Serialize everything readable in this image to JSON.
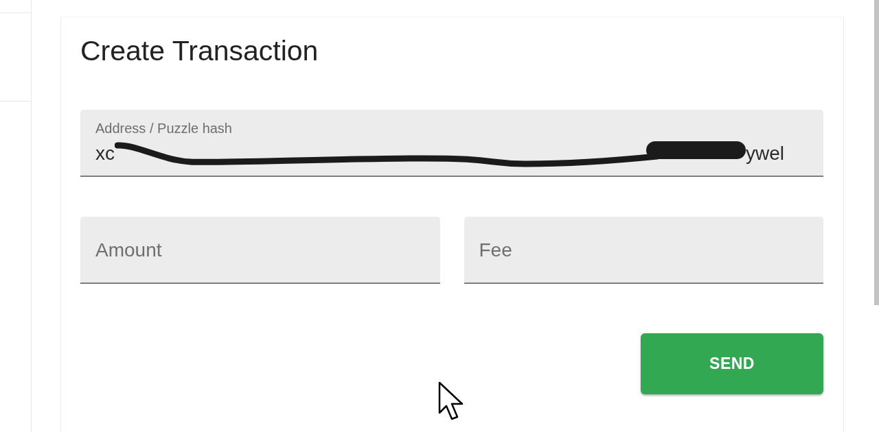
{
  "card": {
    "title": "Create Transaction",
    "address_field": {
      "label": "Address / Puzzle hash",
      "value_parts": [
        {
          "kind": "text",
          "text": "xc"
        },
        {
          "kind": "redacted"
        },
        {
          "kind": "text",
          "text": "ywel"
        }
      ]
    },
    "amount_field": {
      "placeholder": "Amount"
    },
    "fee_field": {
      "placeholder": "Fee"
    },
    "send_button": {
      "label": "SEND"
    }
  }
}
